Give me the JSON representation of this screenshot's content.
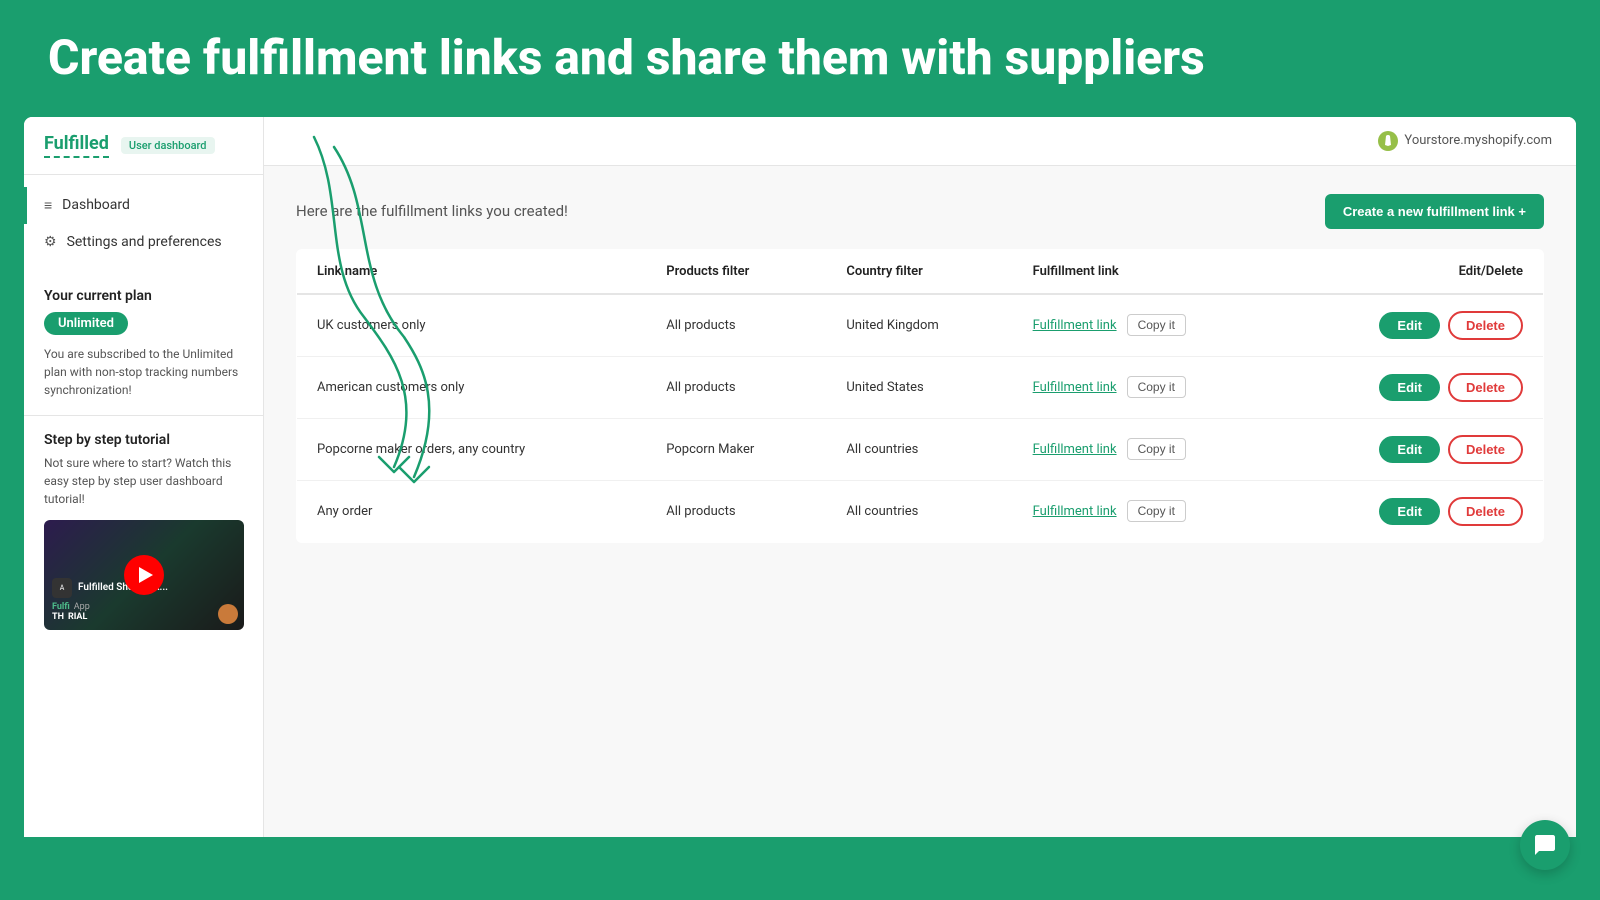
{
  "page": {
    "background_color": "#1a9e6e",
    "hero_title": "Create fulfillment links and share them with suppliers"
  },
  "sidebar": {
    "logo_text": "Fulfilled",
    "dashboard_badge": "User dashboard",
    "nav_items": [
      {
        "id": "dashboard",
        "label": "Dashboard",
        "icon": "≡",
        "active": true
      },
      {
        "id": "settings",
        "label": "Settings and preferences",
        "icon": "⚙"
      }
    ],
    "plan_section": {
      "title": "Your current plan",
      "plan_name": "Unlimited",
      "description": "You are subscribed to the Unlimited plan with non-stop tracking numbers synchronization!"
    },
    "tutorial_section": {
      "title": "Step by step tutorial",
      "description": "Not sure where to start? Watch this easy step by step user dashboard tutorial!",
      "video": {
        "app_label": "App",
        "title": "Fulfilled Shopify A...",
        "subtitle": "Fulfi  App",
        "label_green": "Fulfi",
        "label_white": "RIAL",
        "th_text": "TH"
      }
    }
  },
  "top_bar": {
    "store_url": "Yourstore.myshopify.com"
  },
  "main": {
    "header_text": "Here are the fulfillment links you created!",
    "create_btn_label": "Create a new fulfillment link +",
    "table": {
      "columns": [
        "Link name",
        "Products filter",
        "Country filter",
        "Fulfillment link",
        "Edit/Delete"
      ],
      "rows": [
        {
          "link_name": "UK customers only",
          "products_filter": "All products",
          "country_filter": "United Kingdom",
          "fulfillment_link_text": "Fulfillment link",
          "copy_label": "Copy it",
          "edit_label": "Edit",
          "delete_label": "Delete"
        },
        {
          "link_name": "American customers only",
          "products_filter": "All products",
          "country_filter": "United States",
          "fulfillment_link_text": "Fulfillment link",
          "copy_label": "Copy it",
          "edit_label": "Edit",
          "delete_label": "Delete"
        },
        {
          "link_name": "Popcorne maker orders, any country",
          "products_filter": "Popcorn Maker",
          "country_filter": "All countries",
          "fulfillment_link_text": "Fulfillment link",
          "copy_label": "Copy it",
          "edit_label": "Edit",
          "delete_label": "Delete"
        },
        {
          "link_name": "Any order",
          "products_filter": "All products",
          "country_filter": "All countries",
          "fulfillment_link_text": "Fulfillment link",
          "copy_label": "Copy it",
          "edit_label": "Edit",
          "delete_label": "Delete"
        }
      ]
    }
  },
  "chat": {
    "icon_label": "chat-icon"
  }
}
